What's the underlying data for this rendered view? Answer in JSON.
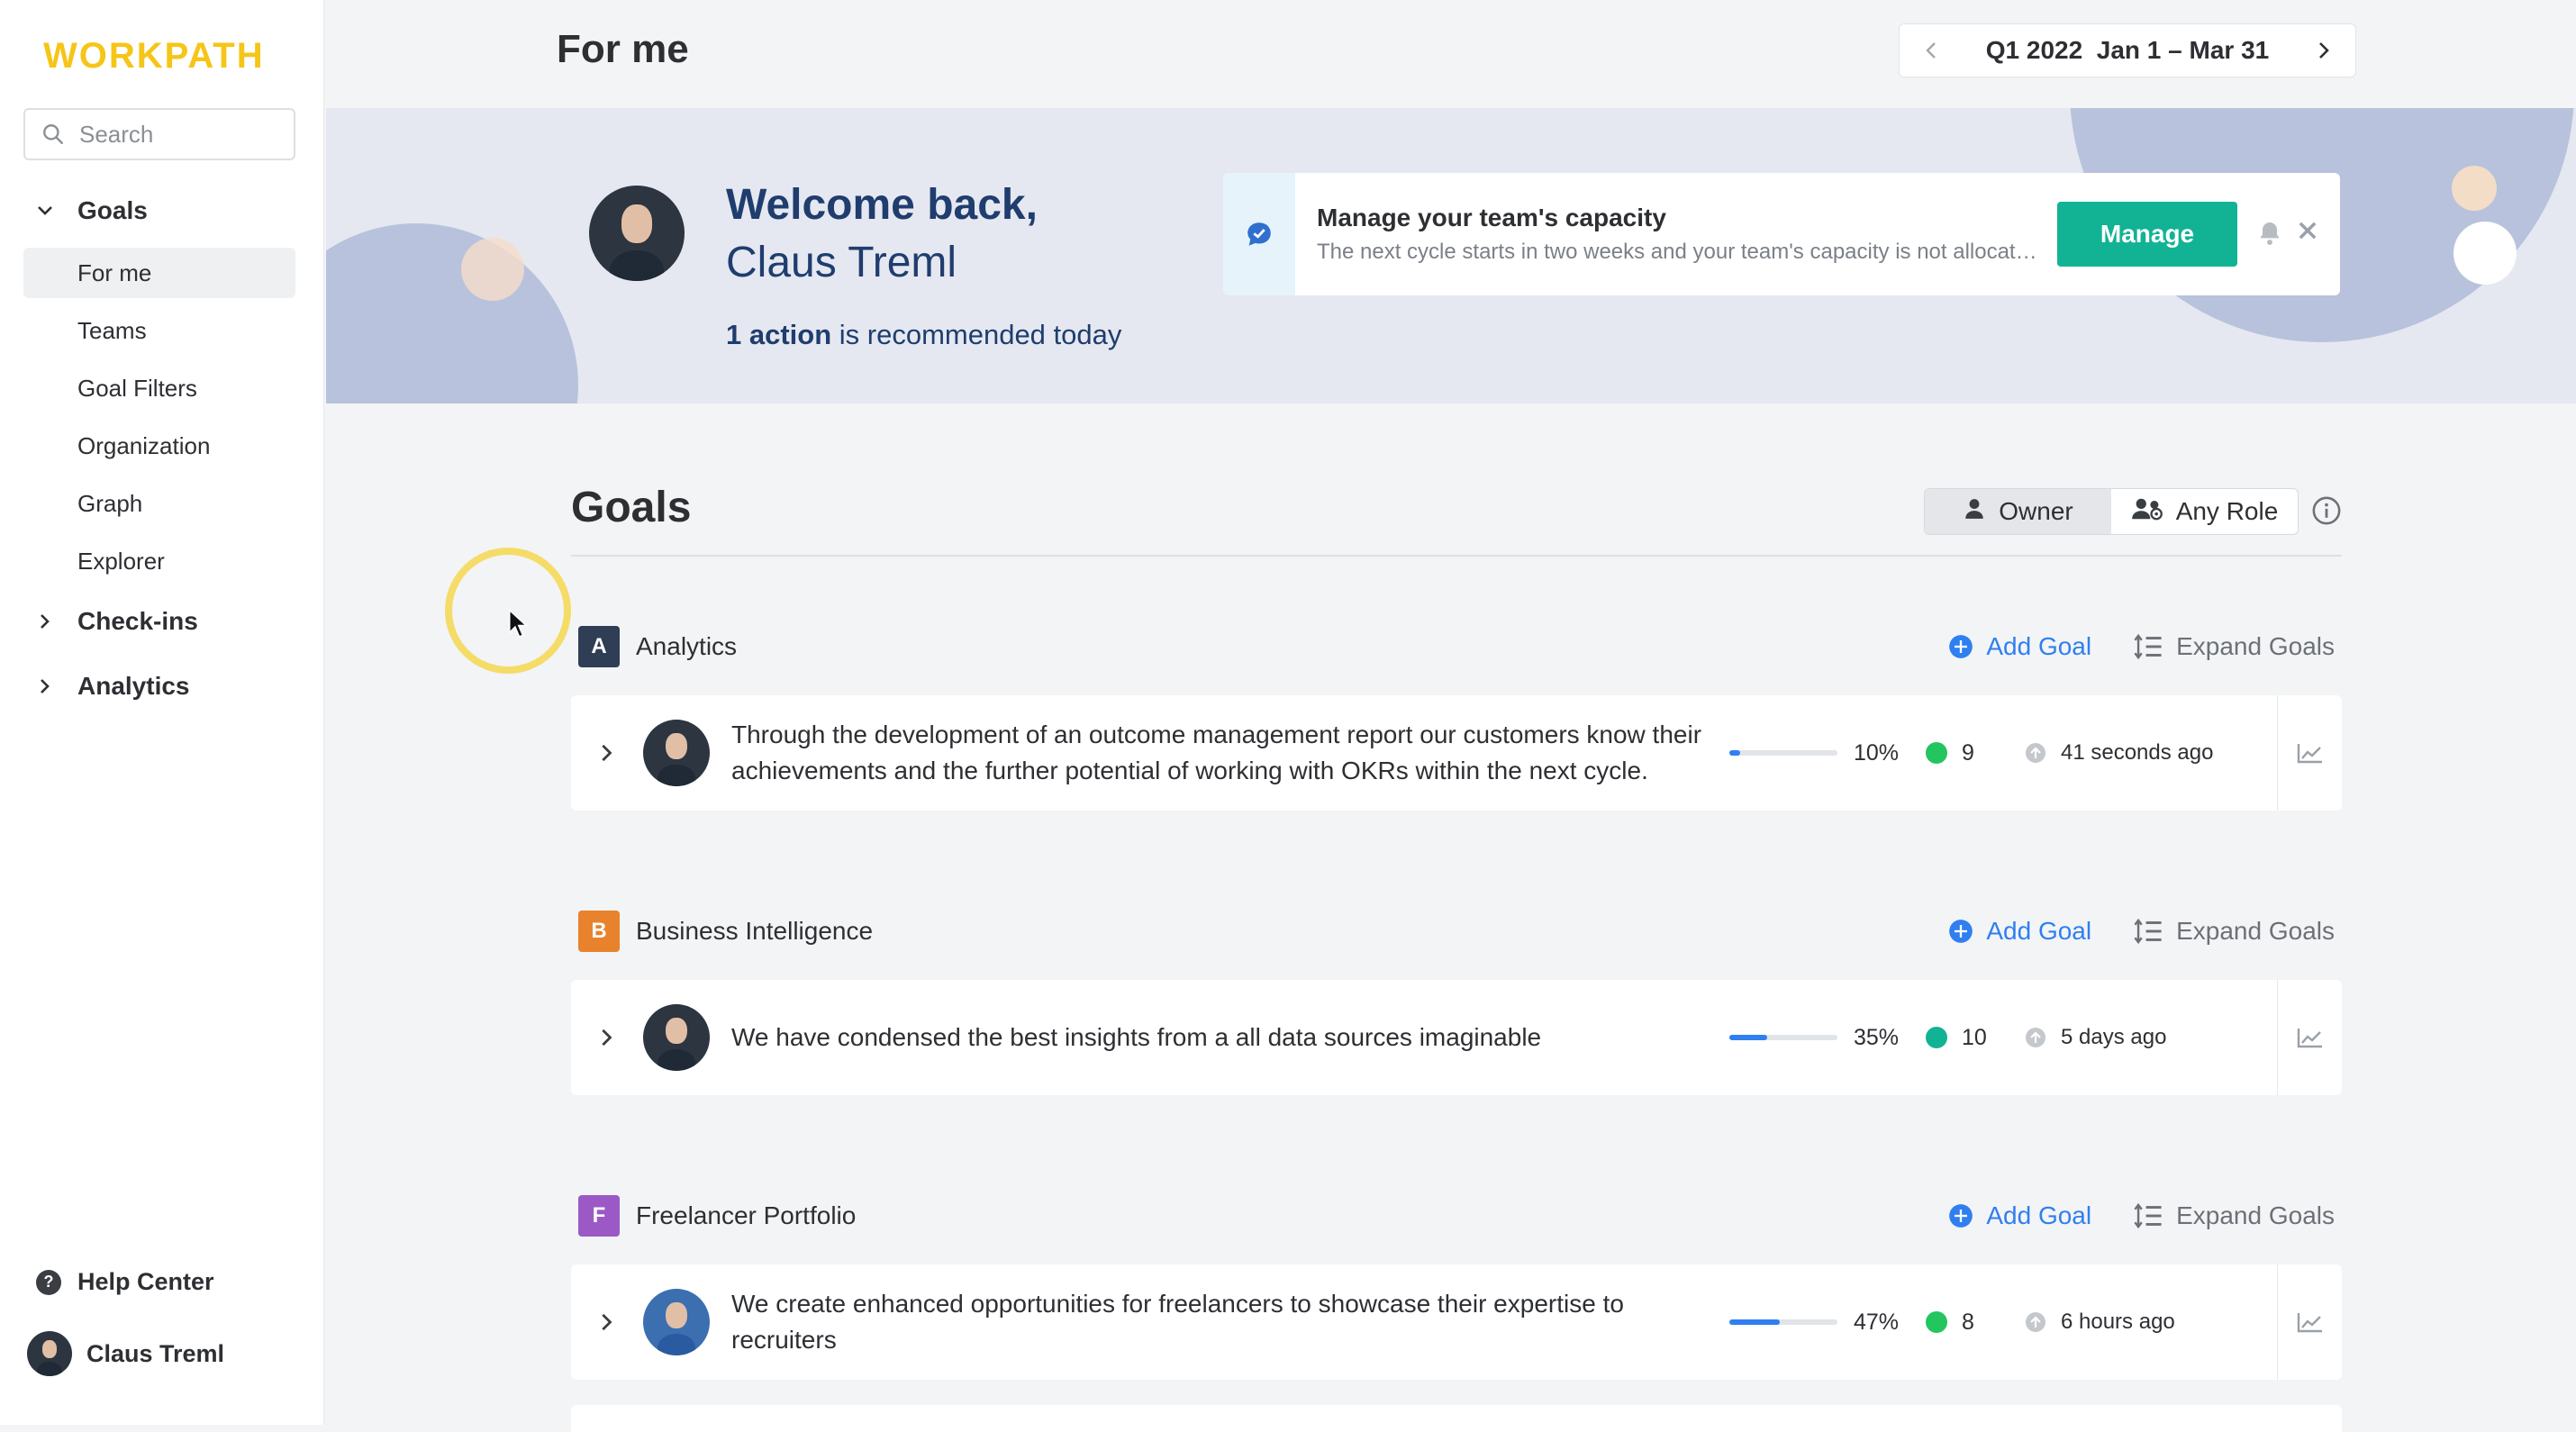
{
  "app": {
    "logo": "WORKPATH"
  },
  "sidebar": {
    "search_placeholder": "Search",
    "sections": [
      {
        "label": "Goals",
        "expanded": true
      },
      {
        "label": "Check-ins",
        "expanded": false
      },
      {
        "label": "Analytics",
        "expanded": false
      }
    ],
    "goal_items": [
      "For me",
      "Teams",
      "Goal Filters",
      "Organization",
      "Graph",
      "Explorer"
    ],
    "active_item": "For me",
    "help_label": "Help Center",
    "help_glyph": "?",
    "user_name": "Claus Treml"
  },
  "header": {
    "title": "For me",
    "period_label": "Q1 2022  Jan 1 – Mar 31"
  },
  "banner": {
    "welcome_line1": "Welcome back,",
    "welcome_line2": "Claus Treml",
    "action_count": "1 action",
    "action_suffix": " is recommended today",
    "notice_title": "Manage your team's capacity",
    "notice_text": "The next cycle starts in two weeks and your team's capacity is not allocated yet.",
    "manage_label": "Manage"
  },
  "goals": {
    "title": "Goals",
    "roles": [
      "Owner",
      "Any Role"
    ],
    "active_role": "Owner",
    "add_label": "Add Goal",
    "expand_label": "Expand Goals",
    "groups": [
      {
        "letter": "A",
        "name": "Analytics",
        "color": "#2f3e55",
        "goal": {
          "text": "Through the development of an outcome management report our customers know their achievements and the further potential of working with OKRs within the next cycle.",
          "progress": 10,
          "progress_label": "10%",
          "key_results": "9",
          "status_color": "#22c55e",
          "updated": "41 seconds ago"
        }
      },
      {
        "letter": "B",
        "name": "Business Intelligence",
        "color": "#e8822c",
        "goal": {
          "text": "We have condensed the best insights from a all data sources imaginable",
          "progress": 35,
          "progress_label": "35%",
          "key_results": "10",
          "status_color": "#12b394",
          "updated": "5 days ago"
        }
      },
      {
        "letter": "F",
        "name": "Freelancer Portfolio",
        "color": "#9b59c6",
        "goal": {
          "text": "We create enhanced opportunities for freelancers to showcase their expertise to recruiters",
          "progress": 47,
          "progress_label": "47%",
          "key_results": "8",
          "status_color": "#22c55e",
          "updated": "6 hours ago"
        }
      }
    ]
  },
  "colors": {
    "accent": "#12b394",
    "link": "#2f7ff0",
    "logo": "#f5c518",
    "banner_text": "#1f3d6e"
  }
}
